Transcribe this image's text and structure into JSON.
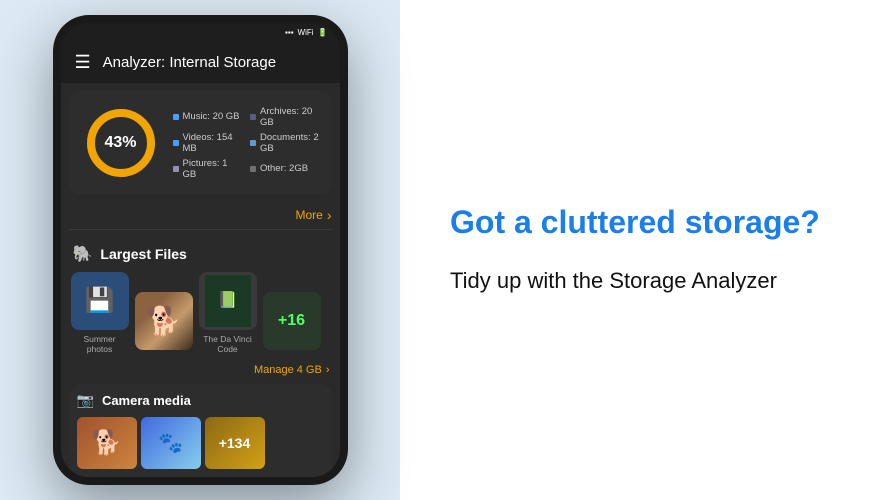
{
  "header": {
    "title": "Analyzer: Internal Storage"
  },
  "storage": {
    "percentage": "43%",
    "legend": [
      {
        "label": "Music: 20 GB",
        "color": "#4a9eff"
      },
      {
        "label": "Archives: 20 GB",
        "color": "#5b5b8a"
      },
      {
        "label": "Videos: 154 MB",
        "color": "#4a9eff"
      },
      {
        "label": "Documents: 2 GB",
        "color": "#5b9ad4"
      },
      {
        "label": "Pictures: 1 GB",
        "color": "#9090b0"
      },
      {
        "label": "Other: 2GB",
        "color": "#707070"
      }
    ],
    "more_label": "More",
    "more_icon": "›"
  },
  "largest_files": {
    "section_title": "Largest Files",
    "files": [
      {
        "label": "Summer photos",
        "type": "usb"
      },
      {
        "label": "",
        "type": "dog"
      },
      {
        "label": "The Da Vinci Code",
        "type": "book"
      },
      {
        "label": "+16",
        "type": "more"
      }
    ],
    "manage_label": "Manage 4 GB",
    "manage_icon": "›"
  },
  "camera_media": {
    "section_title": "Camera media",
    "badge": "+134"
  },
  "promo": {
    "headline": "Got a cluttered storage?",
    "subheadline": "Tidy up with the Storage Analyzer"
  }
}
